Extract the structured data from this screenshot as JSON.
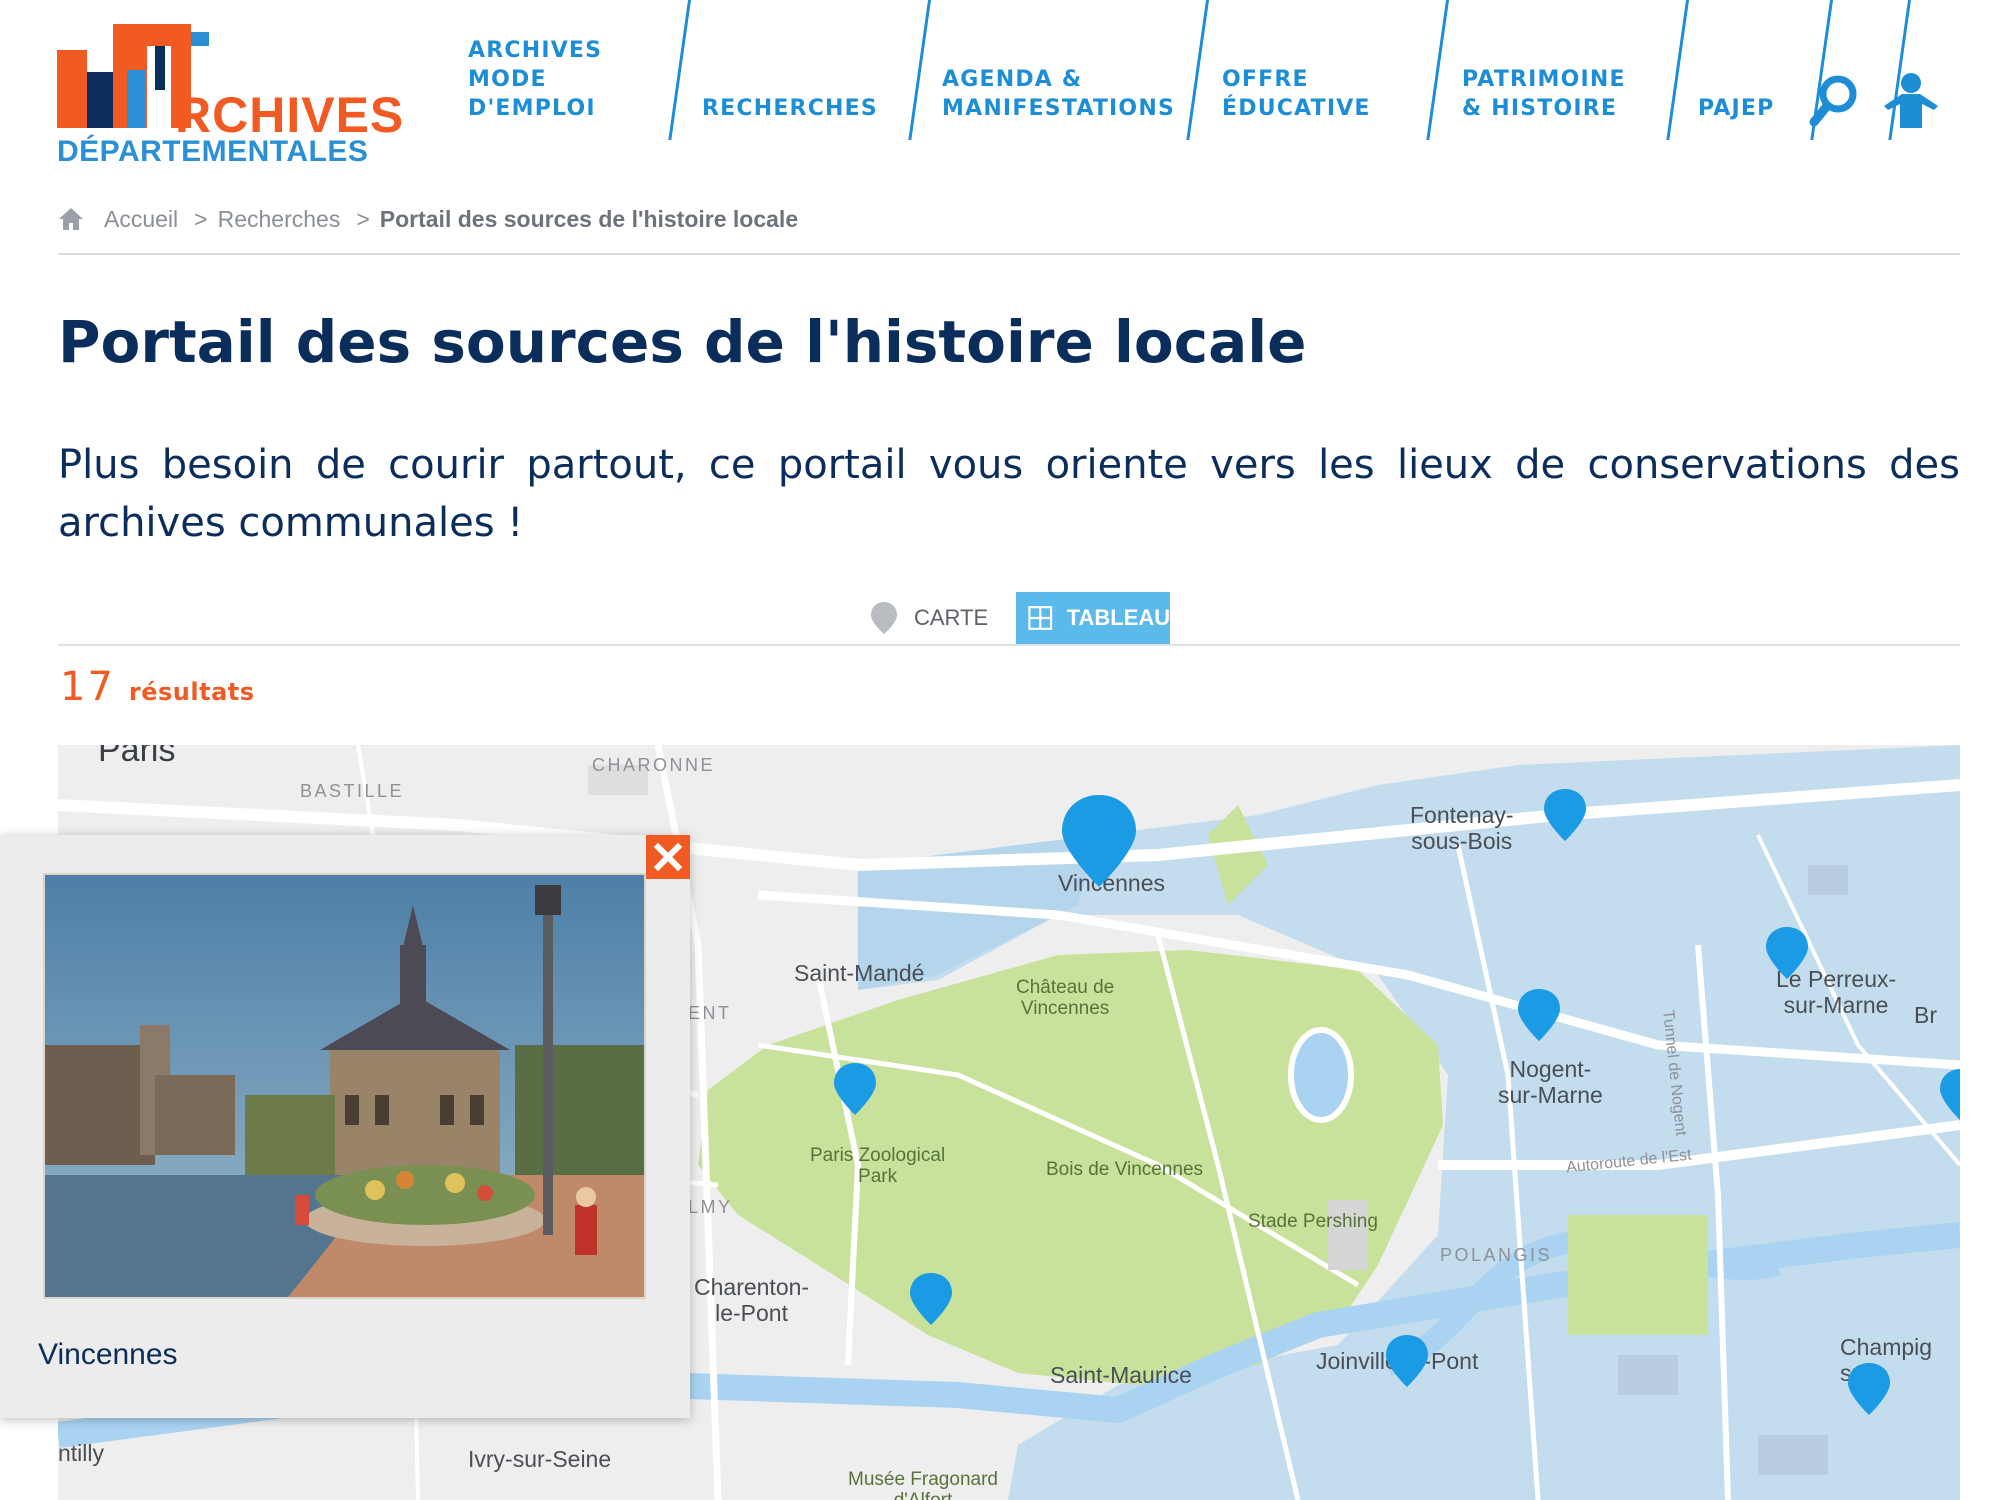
{
  "logo": {
    "word": "RCHIVES",
    "sub": "DÉPARTEMENTALES",
    "colors": {
      "orange": "#f15a22",
      "blue": "#2b8fd6",
      "navy": "#0b2d5b"
    }
  },
  "nav": {
    "items": [
      {
        "label": "ARCHIVES\nMODE\nD'EMPLOI"
      },
      {
        "label": "RECHERCHES"
      },
      {
        "label": "AGENDA &\nMANIFESTATIONS"
      },
      {
        "label": "OFFRE\nÉDUCATIVE"
      },
      {
        "label": "PATRIMOINE\n& HISTOIRE"
      },
      {
        "label": "PAJEP"
      }
    ],
    "search_icon": "search-icon",
    "user_icon": "user-icon"
  },
  "breadcrumb": {
    "home": "Accueil",
    "sep": ">",
    "level1": "Recherches",
    "current": "Portail des sources de l'histoire locale"
  },
  "page": {
    "title": "Portail des sources de l'histoire locale",
    "intro": "Plus besoin de courir partout, ce portail vous oriente vers les lieux de conservations des archives communales !"
  },
  "view_switch": {
    "carte": "CARTE",
    "tableau": "TABLEAU",
    "active": "TABLEAU"
  },
  "results": {
    "count": "17",
    "label": "résultats"
  },
  "map": {
    "labels": {
      "paris": "Paris",
      "bastille": "BASTILLE",
      "charonne": "CHARONNE",
      "fontenay": "Fontenay-\nsous-Bois",
      "vincennes": "Vincennes",
      "saint_mande": "Saint-Mandé",
      "chateau": "Château de\nVincennes",
      "le_perreux": "Le Perreux-\nsur-Marne",
      "br": "Br",
      "nogent": "Nogent-\nsur-Marne",
      "tunnel": "Tunnel de Nogent",
      "zoo": "Paris Zoological\nPark",
      "bois": "Bois de Vincennes",
      "autoroute": "Autoroute de l'Est",
      "stade": "Stade Pershing",
      "polangis": "POLANGIS",
      "charenton": "Charenton-\nle-Pont",
      "saint_maurice": "Saint-Maurice",
      "joinville": "Joinville-le-Pont",
      "champigny": "Champig\nsur-",
      "ent": "ENT",
      "lmy": "LMY",
      "ntilly": "ntilly",
      "ivry": "Ivry-sur-Seine",
      "musee": "Musée Fragonard\nd'Alfort"
    },
    "colors": {
      "marker": "#1a9be3",
      "water": "#aad3f2",
      "park": "#c8e29b",
      "overlay": "#9ccbe9"
    }
  },
  "popup": {
    "title": "Vincennes",
    "close_icon": "close-icon"
  }
}
